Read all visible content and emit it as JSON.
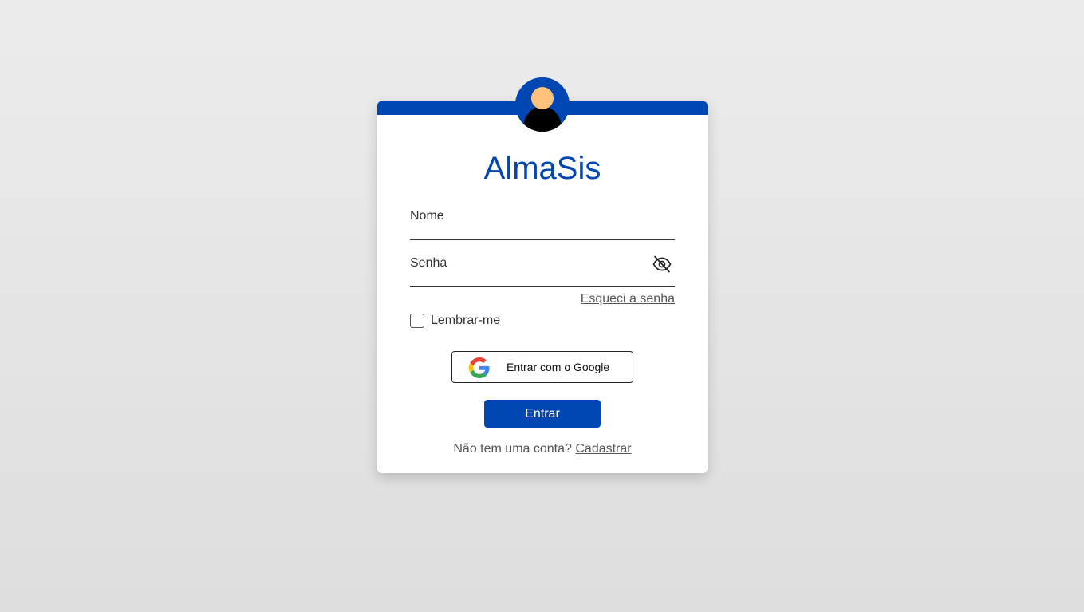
{
  "app": {
    "brand": "AlmaSis",
    "accent_color": "#0047b3"
  },
  "form": {
    "name_label": "Nome",
    "password_label": "Senha",
    "password_toggle_icon": "eye-slash-icon",
    "forgot_password": "Esqueci a senha",
    "remember_me": "Lembrar-me",
    "google_button": "Entrar com o Google",
    "submit_button": "Entrar",
    "signup_prompt": "Não tem uma conta?",
    "signup_link": "Cadastrar"
  },
  "icons": {
    "avatar": "user-avatar-icon",
    "google": "google-logo-icon"
  }
}
